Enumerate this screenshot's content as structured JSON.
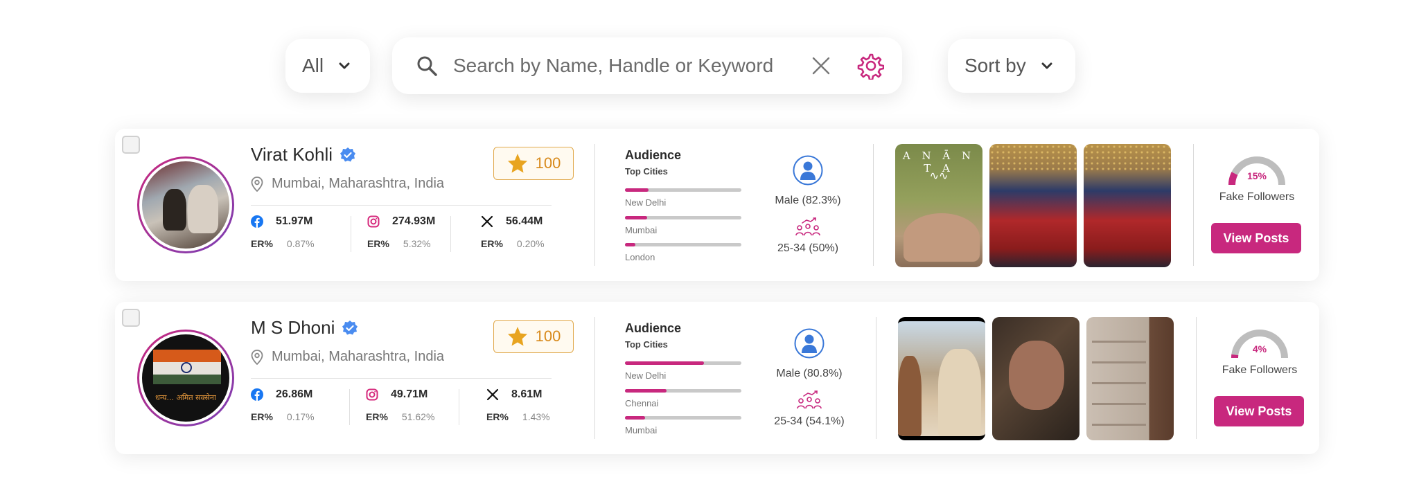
{
  "filter": {
    "label": "All"
  },
  "search": {
    "placeholder": "Search by Name, Handle or Keyword",
    "value": ""
  },
  "sort": {
    "label": "Sort by"
  },
  "colors": {
    "accent": "#c8287e",
    "score_border": "#e0a84a",
    "verified": "#4a8cf0"
  },
  "influencers": [
    {
      "name": "Virat Kohli",
      "location": "Mumbai, Maharashtra, India",
      "score": "100",
      "facebook": {
        "followers": "51.97M",
        "er_label": "ER%",
        "er": "0.87%"
      },
      "instagram": {
        "followers": "274.93M",
        "er_label": "ER%",
        "er": "5.32%"
      },
      "x": {
        "followers": "56.44M",
        "er_label": "ER%",
        "er": "0.20%"
      },
      "audience": {
        "title": "Audience",
        "subtitle": "Top Cities",
        "cities": [
          {
            "name": "New Delhi",
            "share": 0.2
          },
          {
            "name": "Mumbai",
            "share": 0.19
          },
          {
            "name": "London",
            "share": 0.09
          }
        ],
        "gender": "Male (82.3%)",
        "age": "25-34 (50%)"
      },
      "fake_followers": {
        "pct_label": "15%",
        "pct": 15,
        "label": "Fake Followers"
      },
      "view_posts": "View Posts"
    },
    {
      "name": "M S Dhoni",
      "location": "Mumbai, Maharashtra, India",
      "score": "100",
      "facebook": {
        "followers": "26.86M",
        "er_label": "ER%",
        "er": "0.17%"
      },
      "instagram": {
        "followers": "49.71M",
        "er_label": "ER%",
        "er": "51.62%"
      },
      "x": {
        "followers": "8.61M",
        "er_label": "ER%",
        "er": "1.43%"
      },
      "audience": {
        "title": "Audience",
        "subtitle": "Top Cities",
        "cities": [
          {
            "name": "New Delhi",
            "share": 0.68
          },
          {
            "name": "Chennai",
            "share": 0.36
          },
          {
            "name": "Mumbai",
            "share": 0.17
          }
        ],
        "gender": "Male (80.8%)",
        "age": "25-34 (54.1%)"
      },
      "fake_followers": {
        "pct_label": "4%",
        "pct": 4,
        "label": "Fake Followers"
      },
      "view_posts": "View Posts"
    }
  ]
}
